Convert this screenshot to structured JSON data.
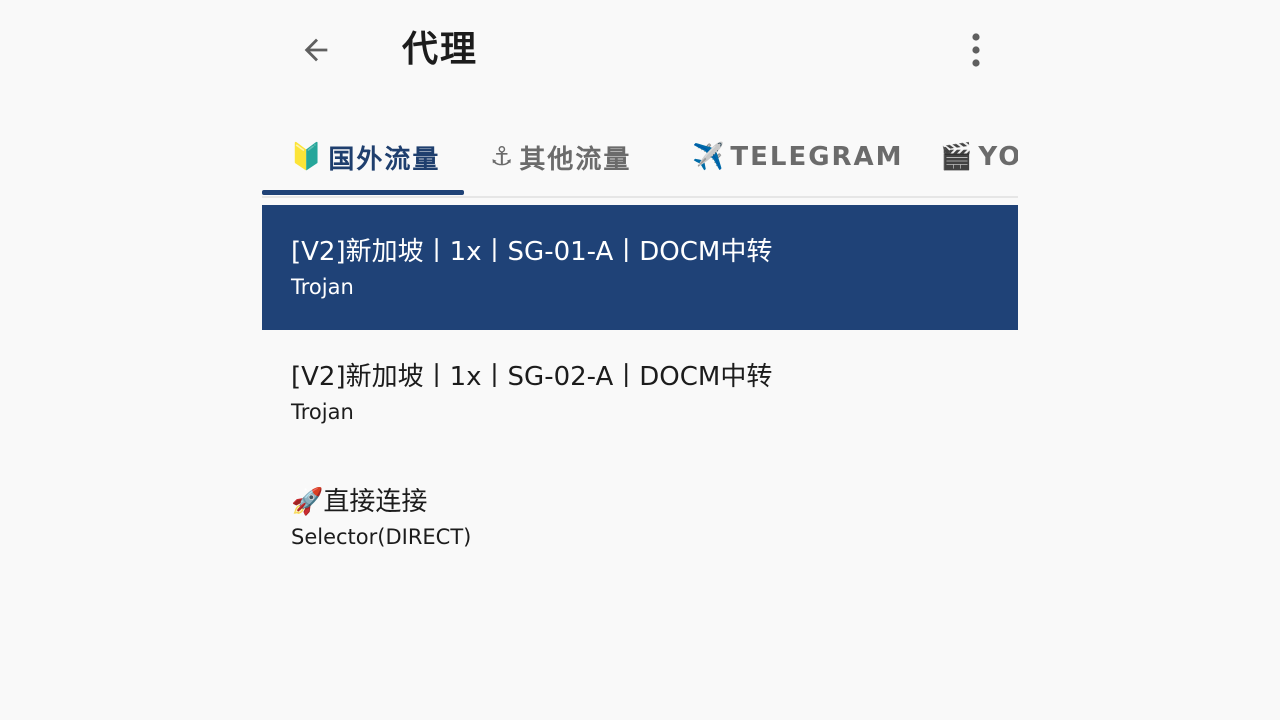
{
  "header": {
    "title": "代理",
    "back_icon": "arrow-left-icon",
    "more_icon": "more-vertical-icon"
  },
  "tabs": [
    {
      "emoji": "🔰",
      "label": "国外流量",
      "active": true
    },
    {
      "emoji": "⚓",
      "label": "其他流量",
      "active": false
    },
    {
      "emoji": "✈️",
      "label": "TELEGRAM",
      "active": false
    },
    {
      "emoji": "🎬",
      "label": "YO",
      "active": false
    }
  ],
  "proxies": [
    {
      "name": "[V2]新加坡丨1x丨SG-01-A丨DOCM中转",
      "type": "Trojan",
      "selected": true
    },
    {
      "name": "[V2]新加坡丨1x丨SG-02-A丨DOCM中转",
      "type": "Trojan",
      "selected": false
    },
    {
      "name": "🚀直接连接",
      "type": "Selector(DIRECT)",
      "selected": false
    }
  ],
  "colors": {
    "accent": "#1f4277",
    "background": "#f9f9f9",
    "tab_inactive": "#6b6b6b"
  }
}
